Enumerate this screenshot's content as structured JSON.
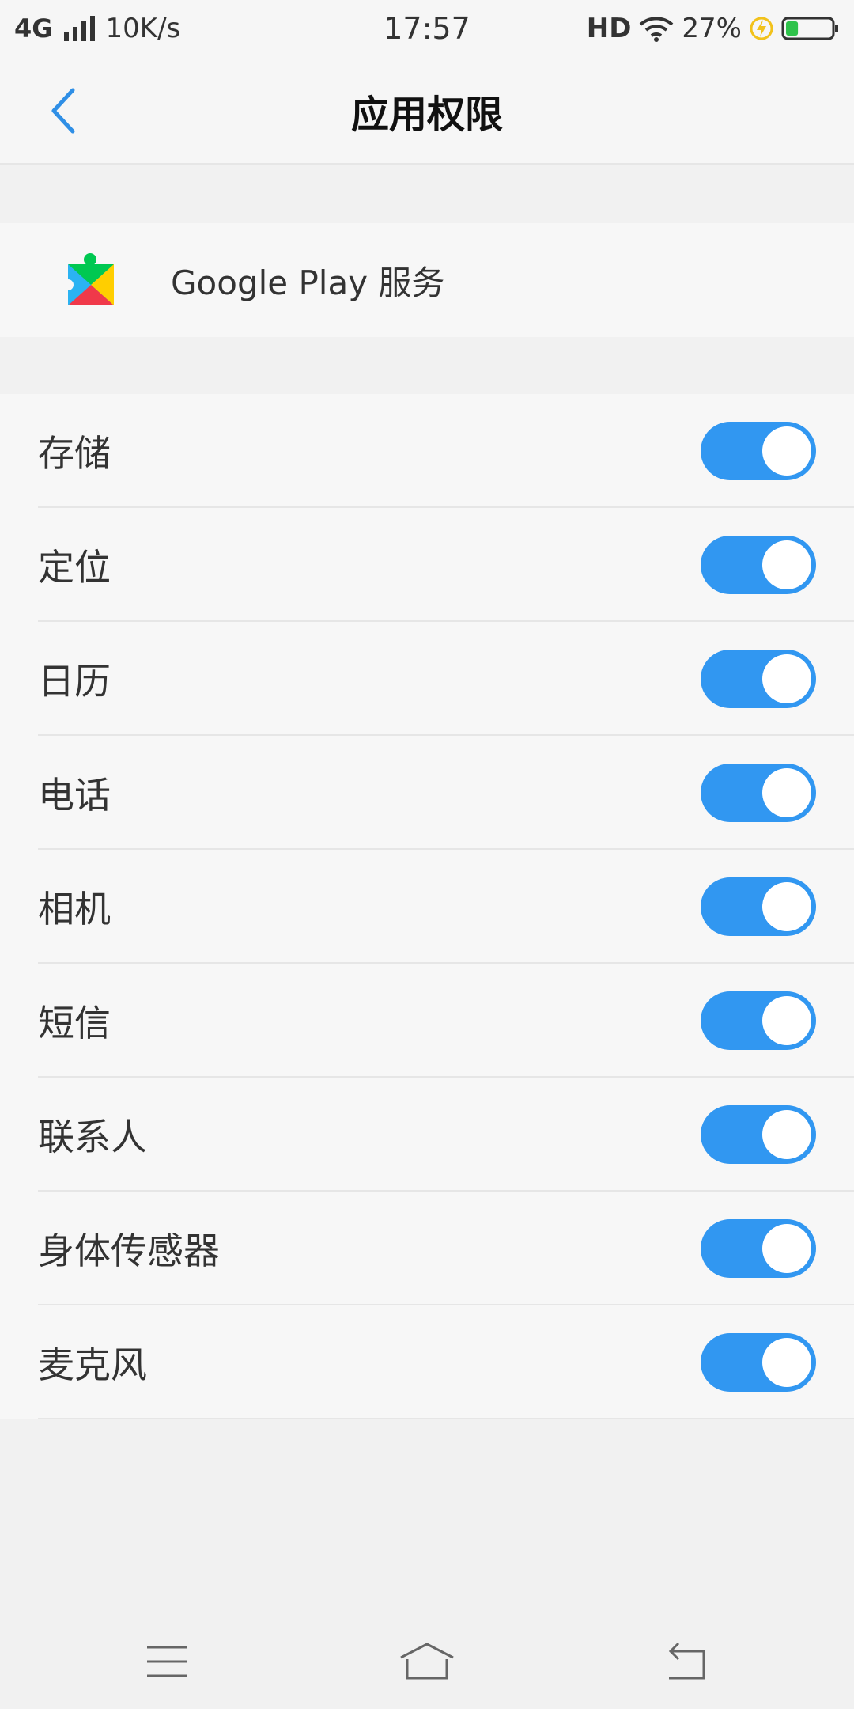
{
  "status_bar": {
    "network": "4G",
    "speed": "10K/s",
    "time": "17:57",
    "hd": "HD",
    "battery_percent": "27%",
    "battery_level": 0.27,
    "icons": [
      "signal-icon",
      "wifi-icon",
      "charging-icon",
      "battery-icon"
    ]
  },
  "header": {
    "title": "应用权限",
    "back_icon": "chevron-left-icon"
  },
  "app": {
    "name": "Google Play 服务",
    "icon": "google-play-services-icon"
  },
  "permissions": [
    {
      "label": "存储",
      "enabled": true
    },
    {
      "label": "定位",
      "enabled": true
    },
    {
      "label": "日历",
      "enabled": true
    },
    {
      "label": "电话",
      "enabled": true
    },
    {
      "label": "相机",
      "enabled": true
    },
    {
      "label": "短信",
      "enabled": true
    },
    {
      "label": "联系人",
      "enabled": true
    },
    {
      "label": "身体传感器",
      "enabled": true
    },
    {
      "label": "麦克风",
      "enabled": true
    }
  ],
  "nav": {
    "icons": [
      "menu-icon",
      "home-icon",
      "back-icon"
    ]
  },
  "colors": {
    "accent": "#3197f1",
    "back_arrow": "#2f8fe6"
  }
}
